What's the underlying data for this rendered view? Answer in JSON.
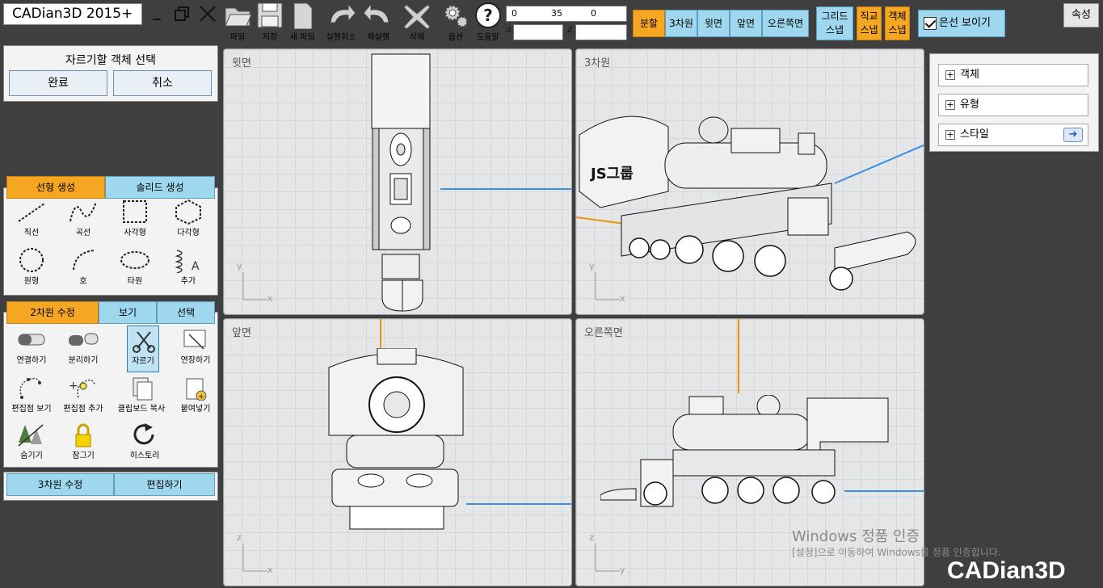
{
  "app": {
    "title": "CADian3D 2015+"
  },
  "toolbar": {
    "file": "파일",
    "save": "저장",
    "new_file": "새 파일",
    "undo": "실행취소",
    "redo": "재실행",
    "delete": "삭제",
    "options": "옵션",
    "help": "도움말"
  },
  "coords": {
    "x": "0",
    "y": "35",
    "z": "0",
    "d_label": "d",
    "angle_label": "∠",
    "d_value": "",
    "angle_value": ""
  },
  "view_buttons": [
    "분할",
    "3차원",
    "윗면",
    "앞면",
    "오른쪽면"
  ],
  "snaps": {
    "grid": [
      "그리드",
      "스냅"
    ],
    "ortho": [
      "직교",
      "스냅"
    ],
    "object": [
      "객체",
      "스냅"
    ]
  },
  "hidden_lines": {
    "label": "은선 보이기",
    "checked": true
  },
  "properties_button": "속성",
  "select_panel": {
    "title": "자르기할 객체 선택",
    "done": "완료",
    "cancel": "취소"
  },
  "create_tabs": [
    "선형 생성",
    "솔리드 생성"
  ],
  "create_tools": [
    "직선",
    "곡선",
    "사각형",
    "다각형",
    "원형",
    "호",
    "타원",
    "추가"
  ],
  "edit_tabs": [
    "2차원 수정",
    "보기",
    "선택"
  ],
  "edit_tools": [
    "연결하기",
    "분리하기",
    "자르기",
    "연장하기",
    "편집점 보기",
    "편집점 추가",
    "클립보드 복사",
    "붙여넣기",
    "숨기기",
    "잠그기",
    "히스토리"
  ],
  "bottom_tabs": [
    "3차원 수정",
    "편집하기"
  ],
  "viewports": {
    "top": {
      "label": "윗면",
      "axis1": "y",
      "axis2": "x"
    },
    "perspective": {
      "label": "3차원",
      "axis1": "y",
      "axis2": "x"
    },
    "front": {
      "label": "앞면",
      "axis1": "z",
      "axis2": "x"
    },
    "right": {
      "label": "오른쪽면",
      "axis1": "z",
      "axis2": "y"
    }
  },
  "model_text": "JS그룹",
  "right_panel": [
    "객체",
    "유형",
    "스타일"
  ],
  "watermark": {
    "line1": "Windows 정품 인증",
    "line2": "[설정]으로 이동하여 Windows를 정품 인증합니다."
  },
  "brand": "CADian3D",
  "colors": {
    "active": "#f5a623",
    "tab": "#9ed7ee",
    "x_axis": "#3c8ee0",
    "y_axis": "#f0900a"
  }
}
